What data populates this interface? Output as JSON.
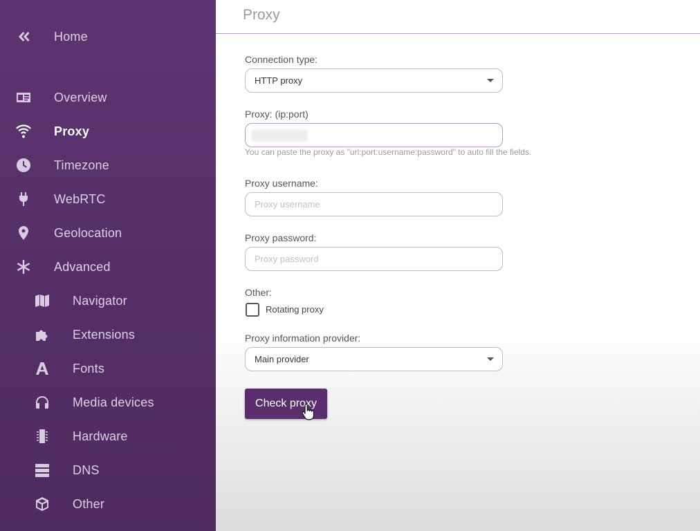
{
  "sidebar": {
    "home": {
      "label": "Home",
      "icon": "double-chevron-left-icon"
    },
    "items": [
      {
        "label": "Overview",
        "icon": "id-card-icon"
      },
      {
        "label": "Proxy",
        "icon": "wifi-icon"
      },
      {
        "label": "Timezone",
        "icon": "clock-icon"
      },
      {
        "label": "WebRTC",
        "icon": "plug-icon"
      },
      {
        "label": "Geolocation",
        "icon": "map-pin-icon"
      },
      {
        "label": "Advanced",
        "icon": "asterisk-icon"
      }
    ],
    "sub_items": [
      {
        "label": "Navigator",
        "icon": "map-icon"
      },
      {
        "label": "Extensions",
        "icon": "puzzle-icon"
      },
      {
        "label": "Fonts",
        "icon": "font-icon"
      },
      {
        "label": "Media devices",
        "icon": "headphones-icon"
      },
      {
        "label": "Hardware",
        "icon": "chip-icon"
      },
      {
        "label": "DNS",
        "icon": "server-icon"
      },
      {
        "label": "Other",
        "icon": "cube-icon"
      }
    ],
    "active": "Proxy",
    "bg_color": "#5e3470"
  },
  "main": {
    "title": "Proxy",
    "connection_type": {
      "label": "Connection type:",
      "value": "HTTP proxy"
    },
    "proxy": {
      "label": "Proxy: (ip:port)",
      "hint": "You can paste the proxy as \"url:port:username:password\" to auto fill the fields."
    },
    "username": {
      "label": "Proxy username:",
      "placeholder": "Proxy username"
    },
    "password": {
      "label": "Proxy password:",
      "placeholder": "Proxy password"
    },
    "other": {
      "label": "Other:",
      "rotating_label": "Rotating proxy",
      "rotating_checked": false
    },
    "provider": {
      "label": "Proxy information provider:",
      "value": "Main provider"
    },
    "check_button": "Check proxy",
    "accent_color": "#5a2d6d"
  }
}
